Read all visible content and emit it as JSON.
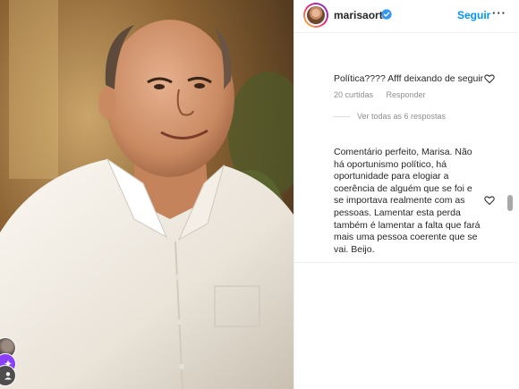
{
  "post": {
    "username": "marisaorth",
    "follow_label": "Seguir",
    "more_label": "···"
  },
  "comments": [
    {
      "text": "Política???? Afff deixando de seguir",
      "likes": "20 curtidas",
      "reply_label": "Responder",
      "view_replies": "Ver todas as 6 respostas"
    },
    {
      "text_lines": [
        "Comentário perfeito, Marisa. Não",
        "há oportunismo político, há",
        "oportunidade para elogiar a",
        "coerência de alguém que se foi e",
        "se importava realmente com as",
        "pessoas. Lamentar esta perda",
        "também é lamentar a falta que fará",
        "mais uma pessoa coerente que se",
        "vai. Beijo."
      ]
    }
  ],
  "colors": {
    "link_blue": "#0095f6",
    "verified_blue": "#3897f0",
    "secondary_text": "#8e8e8e"
  },
  "icons": [
    "verified-icon",
    "more-icon",
    "heart-icon"
  ]
}
